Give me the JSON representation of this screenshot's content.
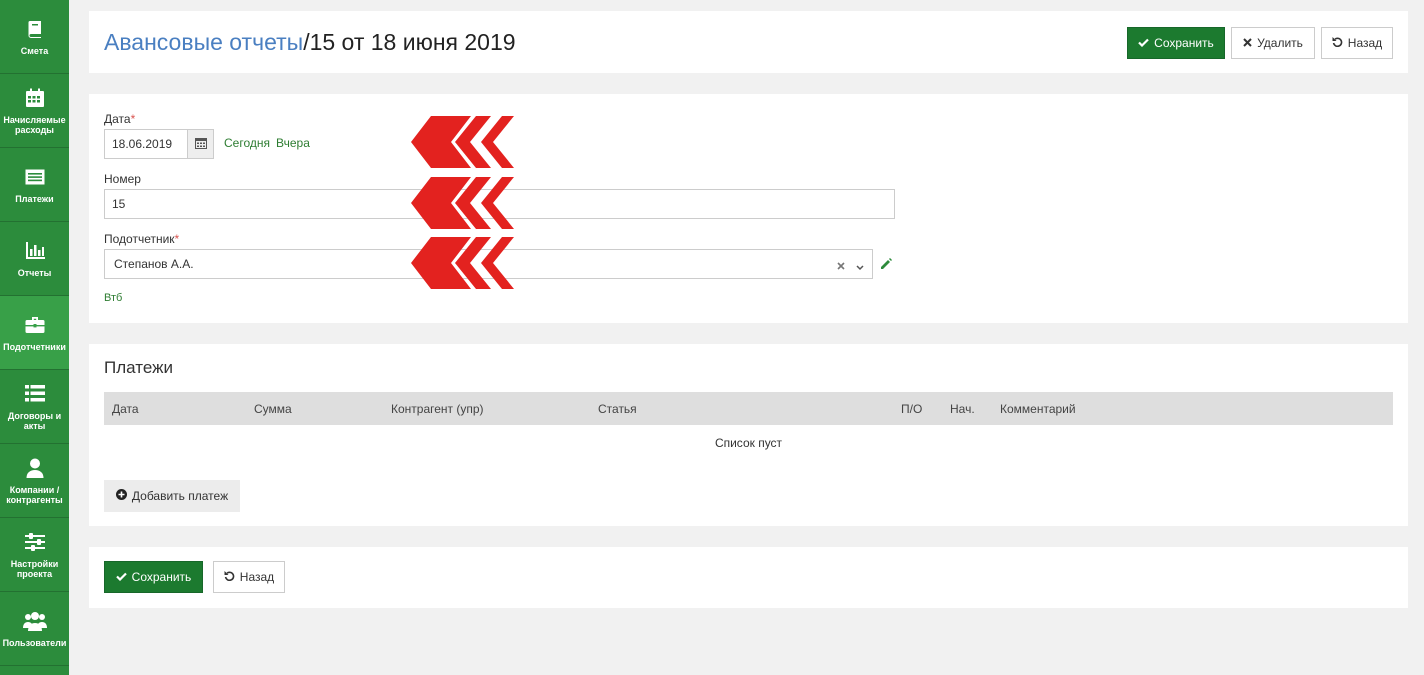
{
  "sidebar": {
    "items": [
      {
        "label": "Смета",
        "icon": "book-icon"
      },
      {
        "label": "Начисляемые расходы",
        "icon": "calendar-icon"
      },
      {
        "label": "Платежи",
        "icon": "list-icon"
      },
      {
        "label": "Отчеты",
        "icon": "bar-chart-icon"
      },
      {
        "label": "Подотчетники",
        "icon": "briefcase-icon"
      },
      {
        "label": "Договоры и акты",
        "icon": "list-bullets-icon"
      },
      {
        "label": "Компании / контрагенты",
        "icon": "user-icon"
      },
      {
        "label": "Настройки проекта",
        "icon": "sliders-icon"
      },
      {
        "label": "Пользователи",
        "icon": "users-icon"
      }
    ]
  },
  "header": {
    "breadcrumb": "Авансовые отчеты",
    "separator": "/",
    "title": "15 от 18 июня 2019",
    "save_label": "Сохранить",
    "delete_label": "Удалить",
    "back_label": "Назад"
  },
  "form": {
    "date_label": "Дата",
    "required_mark": "*",
    "date_value": "18.06.2019",
    "today_link": "Сегодня",
    "yesterday_link": "Вчера",
    "number_label": "Номер",
    "number_value": "15",
    "accountable_label": "Подотчетник",
    "accountable_value": "Степанов А.А.",
    "bank_link": "Втб"
  },
  "payments": {
    "title": "Платежи",
    "columns": [
      "Дата",
      "Сумма",
      "Контрагент (упр)",
      "Статья",
      "П/О",
      "Нач.",
      "Комментарий"
    ],
    "empty_text": "Список пуст",
    "add_label": "Добавить платеж"
  },
  "footer": {
    "save_label": "Сохранить",
    "back_label": "Назад"
  },
  "colors": {
    "sidebar": "#2c8c3c",
    "primary": "#1c7a2f",
    "breadcrumb": "#4a7fc1",
    "arrow": "#e3221f"
  }
}
